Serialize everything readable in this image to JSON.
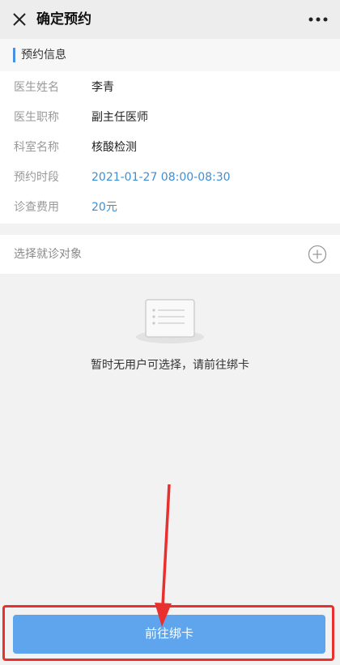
{
  "nav": {
    "title": "确定预约",
    "close_icon": "close-icon",
    "more_icon": "more-icon"
  },
  "appointment": {
    "section_title": "预约信息",
    "rows": [
      {
        "label": "医生姓名",
        "value": "李青",
        "highlight": false
      },
      {
        "label": "医生职称",
        "value": "副主任医师",
        "highlight": false
      },
      {
        "label": "科室名称",
        "value": "核酸检测",
        "highlight": false
      },
      {
        "label": "预约时段",
        "value": "2021-01-27 08:00-08:30",
        "highlight": true
      },
      {
        "label": "诊查费用",
        "value": "20元",
        "highlight": true
      }
    ]
  },
  "patient": {
    "select_label": "选择就诊对象",
    "add_icon": "plus-circle-icon"
  },
  "empty_state": {
    "icon": "empty-list-icon",
    "message": "暂时无用户可选择，请前往绑卡"
  },
  "footer": {
    "bind_card_label": "前往绑卡"
  },
  "colors": {
    "accent": "#4a90e2",
    "link": "#3c8fd6",
    "button": "#5ea5ee",
    "annotation": "#e8312f"
  }
}
